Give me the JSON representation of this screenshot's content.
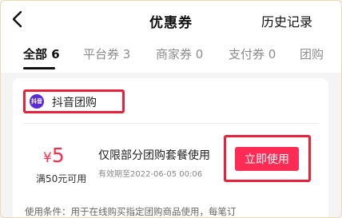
{
  "header": {
    "title": "优惠券",
    "history_label": "历史记录"
  },
  "tabs": [
    {
      "label": "全部 6",
      "active": true
    },
    {
      "label": "平台券 3",
      "active": false
    },
    {
      "label": "商家券 0",
      "active": false
    },
    {
      "label": "支付券 0",
      "active": false
    },
    {
      "label": "团购",
      "active": false
    }
  ],
  "coupon": {
    "merchant_logo_text": "抖音",
    "merchant_name": "抖音团购",
    "currency": "¥",
    "amount": "5",
    "threshold": "满50元可用",
    "description": "仅限部分团购套餐使用",
    "validity": "有效期至2022-06-05 00:06",
    "use_button_label": "立即使用",
    "condition": "使用条件：用于在线购买指定团购商品使用，每笔订"
  },
  "colors": {
    "accent": "#fe2c55",
    "highlight_border": "#e9213b",
    "price": "#ff2b4a",
    "brand_logo": "#5b2bd6"
  }
}
